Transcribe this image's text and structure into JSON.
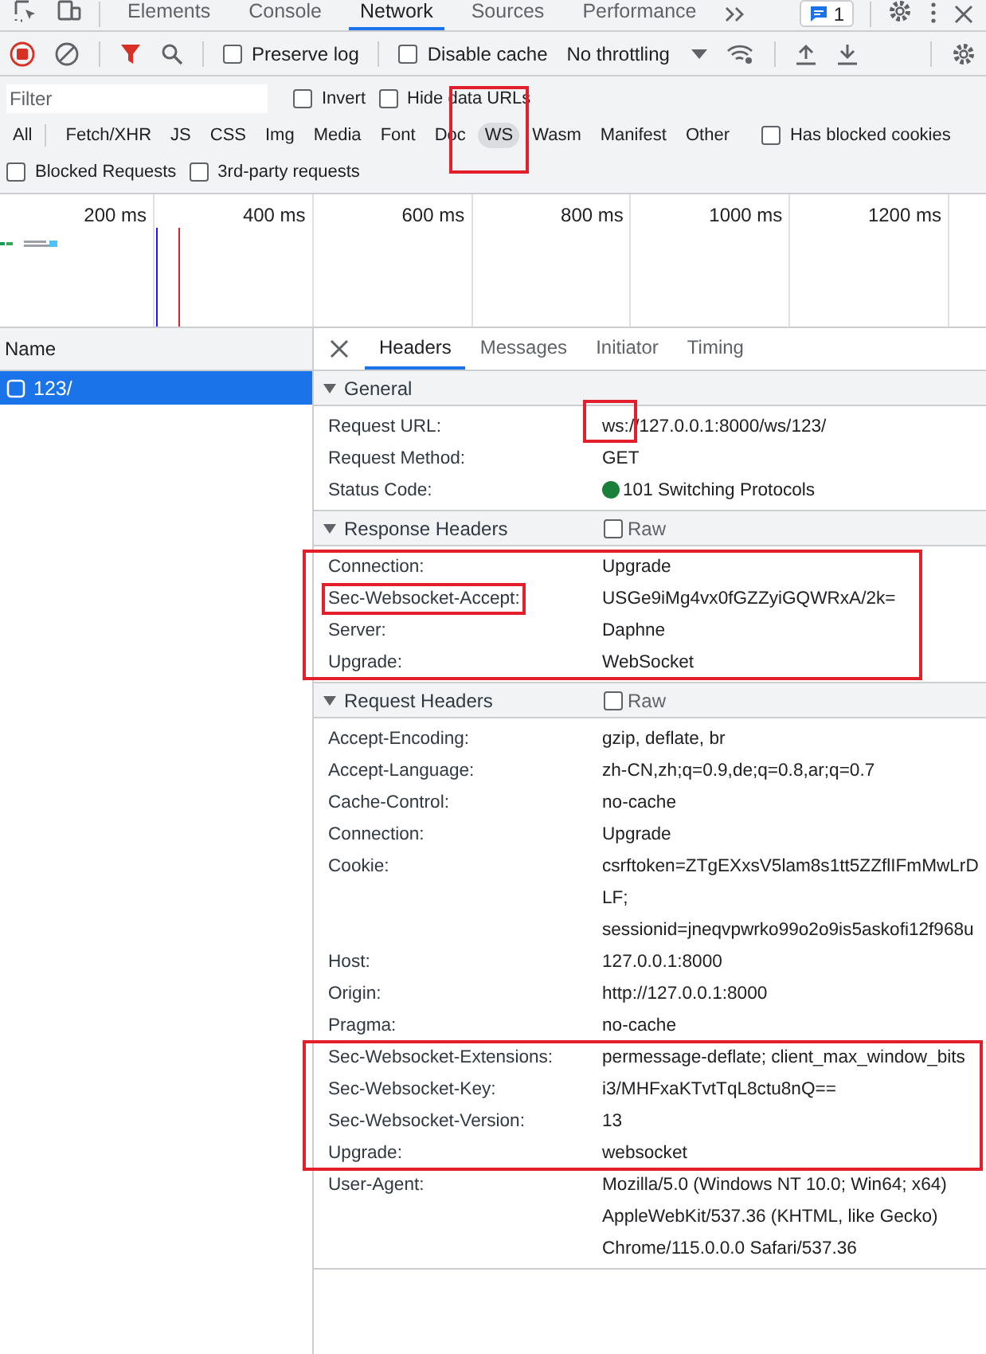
{
  "devtools_tabs": [
    {
      "label": "Elements",
      "selected": false
    },
    {
      "label": "Console",
      "selected": false
    },
    {
      "label": "Network",
      "selected": true
    },
    {
      "label": "Sources",
      "selected": false
    },
    {
      "label": "Performance",
      "selected": false
    }
  ],
  "issues_count": "1",
  "toolbar": {
    "recording": true,
    "checks": [
      {
        "label": "Preserve log",
        "checked": false
      },
      {
        "label": "Disable cache",
        "checked": false
      }
    ],
    "throttling": "No throttling"
  },
  "filter": {
    "placeholder": "Filter",
    "options": [
      {
        "label": "Invert",
        "checked": false
      },
      {
        "label": "Hide data URLs",
        "checked": false
      }
    ]
  },
  "type_filters": [
    {
      "label": "All",
      "selected": false,
      "highlighted": false
    },
    {
      "label": "Fetch/XHR",
      "selected": false,
      "highlighted": false
    },
    {
      "label": "JS",
      "selected": false,
      "highlighted": false
    },
    {
      "label": "CSS",
      "selected": false,
      "highlighted": false
    },
    {
      "label": "Img",
      "selected": false,
      "highlighted": false
    },
    {
      "label": "Media",
      "selected": false,
      "highlighted": false
    },
    {
      "label": "Font",
      "selected": false,
      "highlighted": false
    },
    {
      "label": "Doc",
      "selected": false,
      "highlighted": false
    },
    {
      "label": "WS",
      "selected": true,
      "highlighted": true
    },
    {
      "label": "Wasm",
      "selected": false,
      "highlighted": false
    },
    {
      "label": "Manifest",
      "selected": false,
      "highlighted": false
    },
    {
      "label": "Other",
      "selected": false,
      "highlighted": false
    }
  ],
  "extra_filters": [
    {
      "label": "Has blocked cookies",
      "checked": false
    },
    {
      "label": "Blocked Requests",
      "checked": false
    },
    {
      "label": "3rd-party requests",
      "checked": false
    }
  ],
  "overview": {
    "ticks": [
      "200 ms",
      "400 ms",
      "600 ms",
      "800 ms",
      "1000 ms",
      "1200 ms"
    ]
  },
  "requests": {
    "column": "Name",
    "rows": [
      {
        "name": "123/",
        "selected": true
      }
    ]
  },
  "detail_tabs": [
    {
      "label": "Headers",
      "selected": true
    },
    {
      "label": "Messages",
      "selected": false
    },
    {
      "label": "Initiator",
      "selected": false
    },
    {
      "label": "Timing",
      "selected": false
    }
  ],
  "sections": [
    {
      "title": "General",
      "expanded": true,
      "groups": [
        {
          "highlighted": false,
          "rows": [
            {
              "kind": "text",
              "name": "Request URL:",
              "value": "ws://127.0.0.1:8000/ws/123/",
              "name_highlighted": false,
              "scheme_highlighted": true
            },
            {
              "kind": "text",
              "name": "Request Method:",
              "value": "GET",
              "name_highlighted": false,
              "scheme_highlighted": false
            },
            {
              "kind": "status",
              "name": "Status Code:",
              "value": "101 Switching Protocols",
              "color": "#188038",
              "name_highlighted": false,
              "scheme_highlighted": false
            }
          ]
        }
      ]
    },
    {
      "title": "Response Headers",
      "expanded": true,
      "raw": {
        "label": "Raw",
        "checked": false
      },
      "groups": [
        {
          "highlighted": true,
          "rows": [
            {
              "kind": "text",
              "name": "Connection:",
              "value": "Upgrade",
              "name_highlighted": false,
              "scheme_highlighted": false
            },
            {
              "kind": "text",
              "name": "Sec-Websocket-Accept:",
              "value": "USGe9iMg4vx0fGZZyiGQWRxA/2k=",
              "name_highlighted": true,
              "scheme_highlighted": false
            },
            {
              "kind": "text",
              "name": "Server:",
              "value": "Daphne",
              "name_highlighted": false,
              "scheme_highlighted": false
            },
            {
              "kind": "text",
              "name": "Upgrade:",
              "value": "WebSocket",
              "name_highlighted": false,
              "scheme_highlighted": false
            }
          ]
        }
      ]
    },
    {
      "title": "Request Headers",
      "expanded": true,
      "raw": {
        "label": "Raw",
        "checked": false
      },
      "groups": [
        {
          "highlighted": false,
          "rows": [
            {
              "kind": "text",
              "name": "Accept-Encoding:",
              "value": "gzip, deflate, br",
              "name_highlighted": false,
              "scheme_highlighted": false
            },
            {
              "kind": "text",
              "name": "Accept-Language:",
              "value": "zh-CN,zh;q=0.9,de;q=0.8,ar;q=0.7",
              "name_highlighted": false,
              "scheme_highlighted": false
            },
            {
              "kind": "text",
              "name": "Cache-Control:",
              "value": "no-cache",
              "name_highlighted": false,
              "scheme_highlighted": false
            },
            {
              "kind": "text",
              "name": "Connection:",
              "value": "Upgrade",
              "name_highlighted": false,
              "scheme_highlighted": false
            },
            {
              "kind": "text",
              "name": "Cookie:",
              "value": "csrftoken=ZTgEXxsV5lam8s1tt5ZZflIFmMwLrDLF; sessionid=jneqvpwrko99o2o9is5askofi12f968u",
              "name_highlighted": false,
              "scheme_highlighted": false
            },
            {
              "kind": "text",
              "name": "Host:",
              "value": "127.0.0.1:8000",
              "name_highlighted": false,
              "scheme_highlighted": false
            },
            {
              "kind": "text",
              "name": "Origin:",
              "value": "http://127.0.0.1:8000",
              "name_highlighted": false,
              "scheme_highlighted": false
            },
            {
              "kind": "text",
              "name": "Pragma:",
              "value": "no-cache",
              "name_highlighted": false,
              "scheme_highlighted": false
            }
          ]
        },
        {
          "highlighted": true,
          "rows": [
            {
              "kind": "text",
              "name": "Sec-Websocket-Extensions:",
              "value": "permessage-deflate; client_max_window_bits",
              "name_highlighted": false,
              "scheme_highlighted": false
            },
            {
              "kind": "text",
              "name": "Sec-Websocket-Key:",
              "value": "i3/MHFxaKTvtTqL8ctu8nQ==",
              "name_highlighted": false,
              "scheme_highlighted": false
            },
            {
              "kind": "text",
              "name": "Sec-Websocket-Version:",
              "value": "13",
              "name_highlighted": false,
              "scheme_highlighted": false
            },
            {
              "kind": "text",
              "name": "Upgrade:",
              "value": "websocket",
              "name_highlighted": false,
              "scheme_highlighted": false
            }
          ]
        },
        {
          "highlighted": false,
          "rows": [
            {
              "kind": "text",
              "name": "User-Agent:",
              "value": "Mozilla/5.0 (Windows NT 10.0; Win64; x64) AppleWebKit/537.36 (KHTML, like Gecko) Chrome/115.0.0.0 Safari/537.36",
              "name_highlighted": false,
              "scheme_highlighted": false
            }
          ]
        }
      ]
    }
  ]
}
